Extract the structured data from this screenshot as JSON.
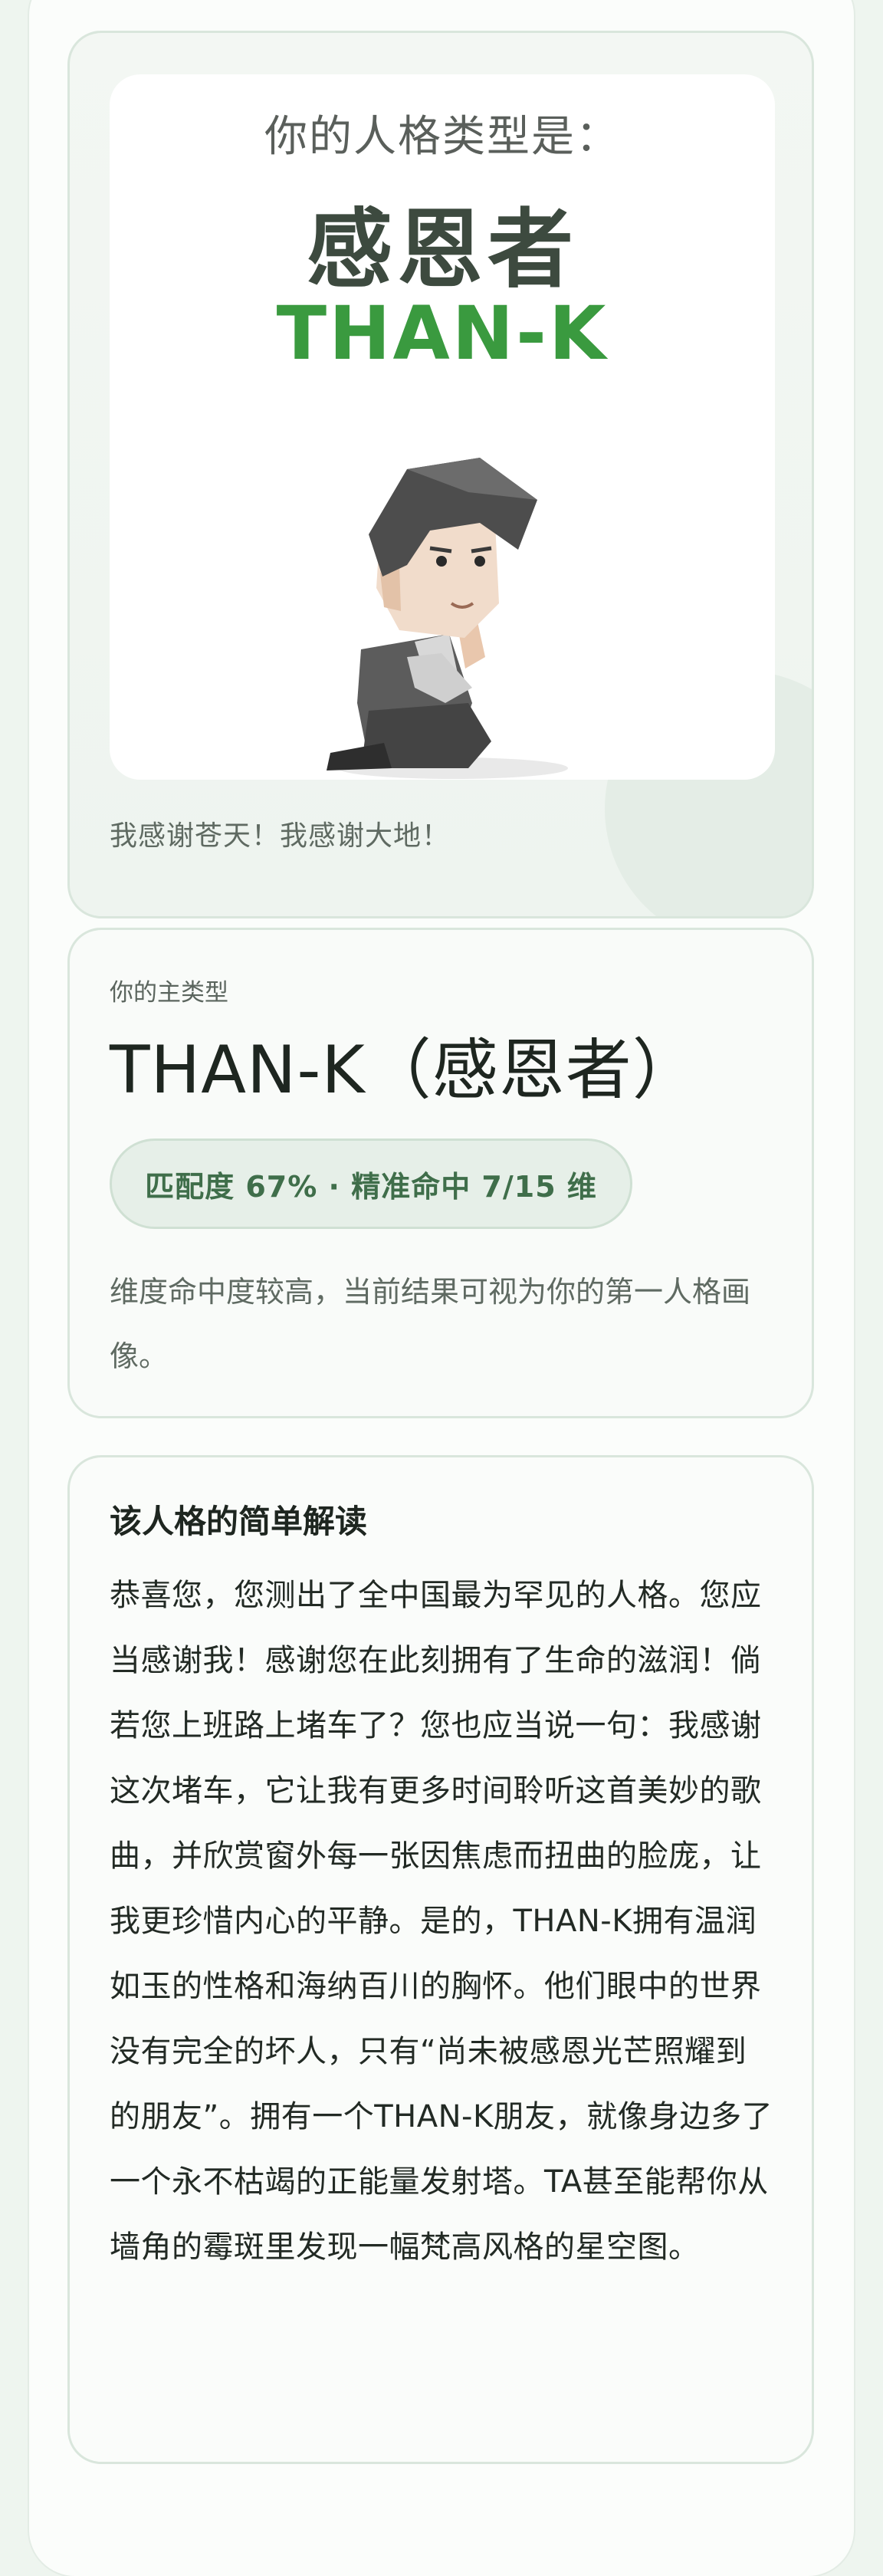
{
  "hero": {
    "question": "你的人格类型是：",
    "type_name": "感恩者",
    "type_code": "THAN-K",
    "caption": "我感谢苍天！我感谢大地！"
  },
  "main": {
    "label": "你的主类型",
    "title": "THAN-K（感恩者）",
    "match": "匹配度 67% · 精准命中 7/15 维",
    "note": "维度命中度较高，当前结果可视为你的第一人格画像。"
  },
  "interp": {
    "title": "该人格的简单解读",
    "body": "恭喜您，您测出了全中国最为罕见的人格。您应当感谢我！感谢您在此刻拥有了生命的滋润！倘若您上班路上堵车了？您也应当说一句：我感谢这次堵车，它让我有更多时间聆听这首美妙的歌曲，并欣赏窗外每一张因焦虑而扭曲的脸庞，让我更珍惜内心的平静。是的，THAN-K拥有温润如玉的性格和海纳百川的胸怀。他们眼中的世界没有完全的坏人，只有“尚未被感恩光芒照耀到的朋友”。拥有一个THAN-K朋友，就像身边多了一个永不枯竭的正能量发射塔。TA甚至能帮你从墙角的霉斑里发现一幅梵高风格的星空图。"
  },
  "colors": {
    "accent": "#3a9a3f",
    "background": "#eef5ef",
    "card_border": "#d9e6dc"
  }
}
